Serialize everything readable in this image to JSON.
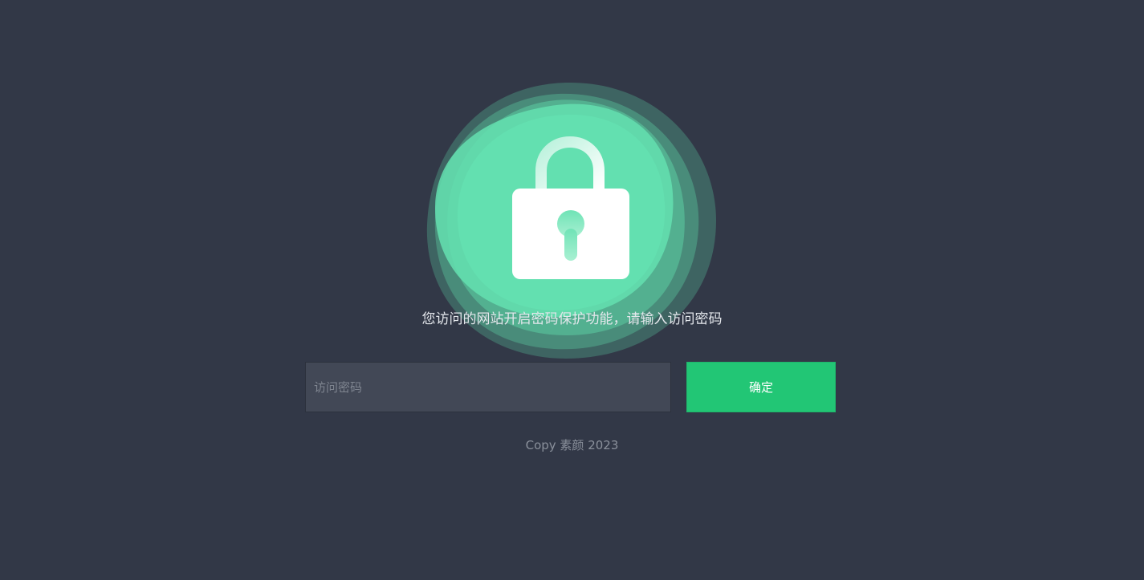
{
  "message": "您访问的网站开启密码保护功能，请输入访问密码",
  "form": {
    "password_placeholder": "访问密码",
    "password_value": "",
    "confirm_label": "确定"
  },
  "footer": {
    "copyright": "Copy 素颜 2023"
  },
  "icons": {
    "lock": "lock-icon"
  },
  "colors": {
    "background": "#323847",
    "accent": "#22c675",
    "blob": "#64e0b0",
    "input_background": "#424856"
  }
}
